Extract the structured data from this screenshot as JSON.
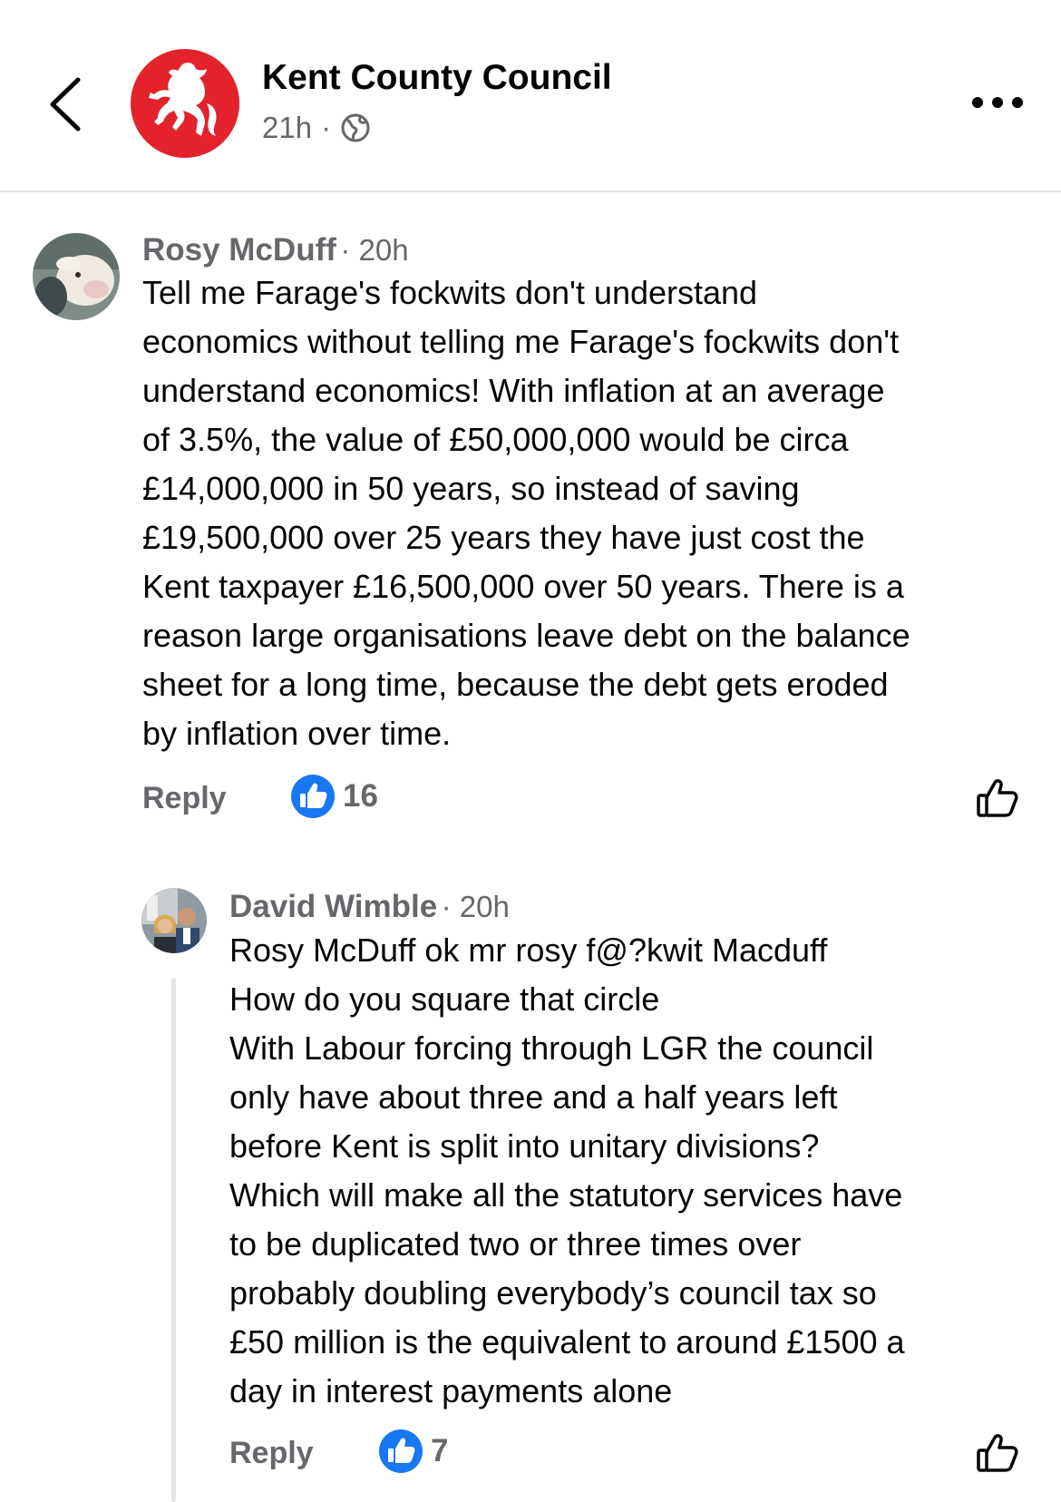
{
  "header": {
    "page_name": "Kent County Council",
    "time": "21h",
    "separator": "·",
    "back_icon": "chevron-left-icon",
    "audience_icon": "globe-icon",
    "more_icon": "more-horizontal-icon",
    "brand_color": "#e3222b"
  },
  "comments": [
    {
      "author": "Rosy McDuff",
      "time": "· 20h",
      "text": "Tell me Farage's fockwits don't understand\neconomics without telling me Farage's fockwits don't\nunderstand economics! With inflation at an average\nof 3.5%, the value of £50,000,000 would be circa\n£14,000,000 in 50 years, so instead of saving\n£19,500,000 over 25 years they have just cost the\nKent taxpayer £16,500,000 over 50 years. There is a\nreason large organisations leave debt on the balance\nsheet for a long time, because the debt gets eroded\nby inflation over time.",
      "reply_label": "Reply",
      "like_count": "16"
    },
    {
      "author": "David Wimble",
      "time": "· 20h",
      "text": "Rosy McDuff ok mr rosy f@?kwit Macduff\nHow do you square that circle\nWith Labour forcing through LGR the council\nonly have about three and a half years left\nbefore Kent is split into unitary divisions?\nWhich will make all the statutory services have\nto be duplicated two or three times over\nprobably doubling everybody’s council tax so\n£50 million is the equivalent to around £1500 a\nday in interest payments alone",
      "reply_label": "Reply",
      "like_count": "7"
    }
  ],
  "colors": {
    "like_blue": "#1877f2",
    "secondary_text": "#65676b",
    "divider": "#e4e6eb"
  }
}
